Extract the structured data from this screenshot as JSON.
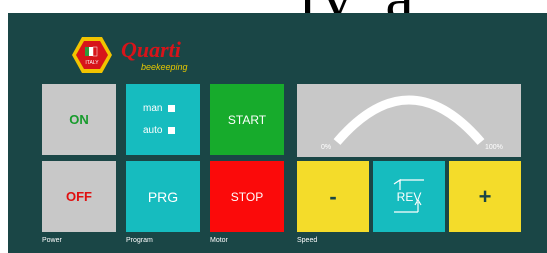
{
  "background_text": "rv_a",
  "brand": {
    "name": "Quarti",
    "tagline": "beekeeping",
    "badge": "ITALY"
  },
  "power": {
    "on_label": "ON",
    "off_label": "OFF",
    "group_label": "Power"
  },
  "program": {
    "man_label": "man",
    "auto_label": "auto",
    "prg_label": "PRG",
    "group_label": "Program"
  },
  "motor": {
    "start_label": "START",
    "stop_label": "STOP",
    "group_label": "Motor"
  },
  "speed": {
    "min_label": "0%",
    "max_label": "100%",
    "minus_label": "-",
    "rev_label": "REV",
    "plus_label": "+",
    "group_label": "Speed"
  },
  "colors": {
    "panel": "#1a4646",
    "gray": "#c8c8c8",
    "teal": "#16bcbf",
    "green": "#17ab2c",
    "red": "#fb0a0a",
    "yellow": "#f4dc2a"
  }
}
